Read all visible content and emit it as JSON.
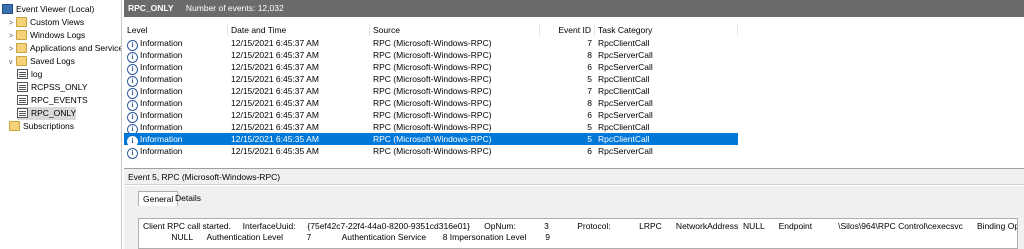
{
  "tree": {
    "root_label": "Event Viewer (Local)",
    "items": [
      {
        "label": "Custom Views",
        "icon": "folder-icon",
        "expander": ">"
      },
      {
        "label": "Windows Logs",
        "icon": "folder-icon",
        "expander": ">"
      },
      {
        "label": "Applications and Services",
        "icon": "folder-icon",
        "expander": ">"
      },
      {
        "label": "Saved Logs",
        "icon": "folder-icon",
        "expander": "v"
      },
      {
        "label": "log",
        "icon": "log-icon"
      },
      {
        "label": "RCPSS_ONLY",
        "icon": "log-icon"
      },
      {
        "label": "RPC_EVENTS",
        "icon": "log-icon"
      },
      {
        "label": "RPC_ONLY",
        "icon": "log-icon",
        "selected": true
      },
      {
        "label": "Subscriptions",
        "icon": "folder-icon"
      }
    ]
  },
  "header": {
    "log_name": "RPC_ONLY",
    "event_count": "Number of events: 12,032"
  },
  "grid": {
    "columns": [
      "Level",
      "Date and Time",
      "Source",
      "Event ID",
      "Task Category"
    ],
    "rows": [
      {
        "level": "Information",
        "date": "12/15/2021 6:45:37 AM",
        "source": "RPC (Microsoft-Windows-RPC)",
        "event_id": "7",
        "category": "RpcClientCall"
      },
      {
        "level": "Information",
        "date": "12/15/2021 6:45:37 AM",
        "source": "RPC (Microsoft-Windows-RPC)",
        "event_id": "8",
        "category": "RpcServerCall"
      },
      {
        "level": "Information",
        "date": "12/15/2021 6:45:37 AM",
        "source": "RPC (Microsoft-Windows-RPC)",
        "event_id": "6",
        "category": "RpcServerCall"
      },
      {
        "level": "Information",
        "date": "12/15/2021 6:45:37 AM",
        "source": "RPC (Microsoft-Windows-RPC)",
        "event_id": "5",
        "category": "RpcClientCall"
      },
      {
        "level": "Information",
        "date": "12/15/2021 6:45:37 AM",
        "source": "RPC (Microsoft-Windows-RPC)",
        "event_id": "7",
        "category": "RpcClientCall"
      },
      {
        "level": "Information",
        "date": "12/15/2021 6:45:37 AM",
        "source": "RPC (Microsoft-Windows-RPC)",
        "event_id": "8",
        "category": "RpcServerCall"
      },
      {
        "level": "Information",
        "date": "12/15/2021 6:45:37 AM",
        "source": "RPC (Microsoft-Windows-RPC)",
        "event_id": "6",
        "category": "RpcServerCall"
      },
      {
        "level": "Information",
        "date": "12/15/2021 6:45:37 AM",
        "source": "RPC (Microsoft-Windows-RPC)",
        "event_id": "5",
        "category": "RpcClientCall"
      },
      {
        "level": "Information",
        "date": "12/15/2021 6:45:35 AM",
        "source": "RPC (Microsoft-Windows-RPC)",
        "event_id": "5",
        "category": "RpcClientCall",
        "selected": true
      },
      {
        "level": "Information",
        "date": "12/15/2021 6:45:35 AM",
        "source": "RPC (Microsoft-Windows-RPC)",
        "event_id": "6",
        "category": "RpcServerCall"
      }
    ]
  },
  "detail": {
    "title": "Event 5, RPC (Microsoft-Windows-RPC)",
    "tabs": [
      "General",
      "Details"
    ],
    "message_line1": "Client RPC call started.     InterfaceUuid:     {75ef42c7-22f4-44a0-8200-9351cd316e01}      OpNum:            3            Protocol:            LRPC      NetworkAddress  NULL      Endpoint           \\Silos\\964\\RPC Control\\cexecsvc      Binding Options",
    "message_line2": "            NULL      Authentication Level          7             Authentication Service       8 Impersonation Level        9"
  },
  "colors": {
    "selection": "#0078d7",
    "titlebar": "#6b6b6b"
  }
}
